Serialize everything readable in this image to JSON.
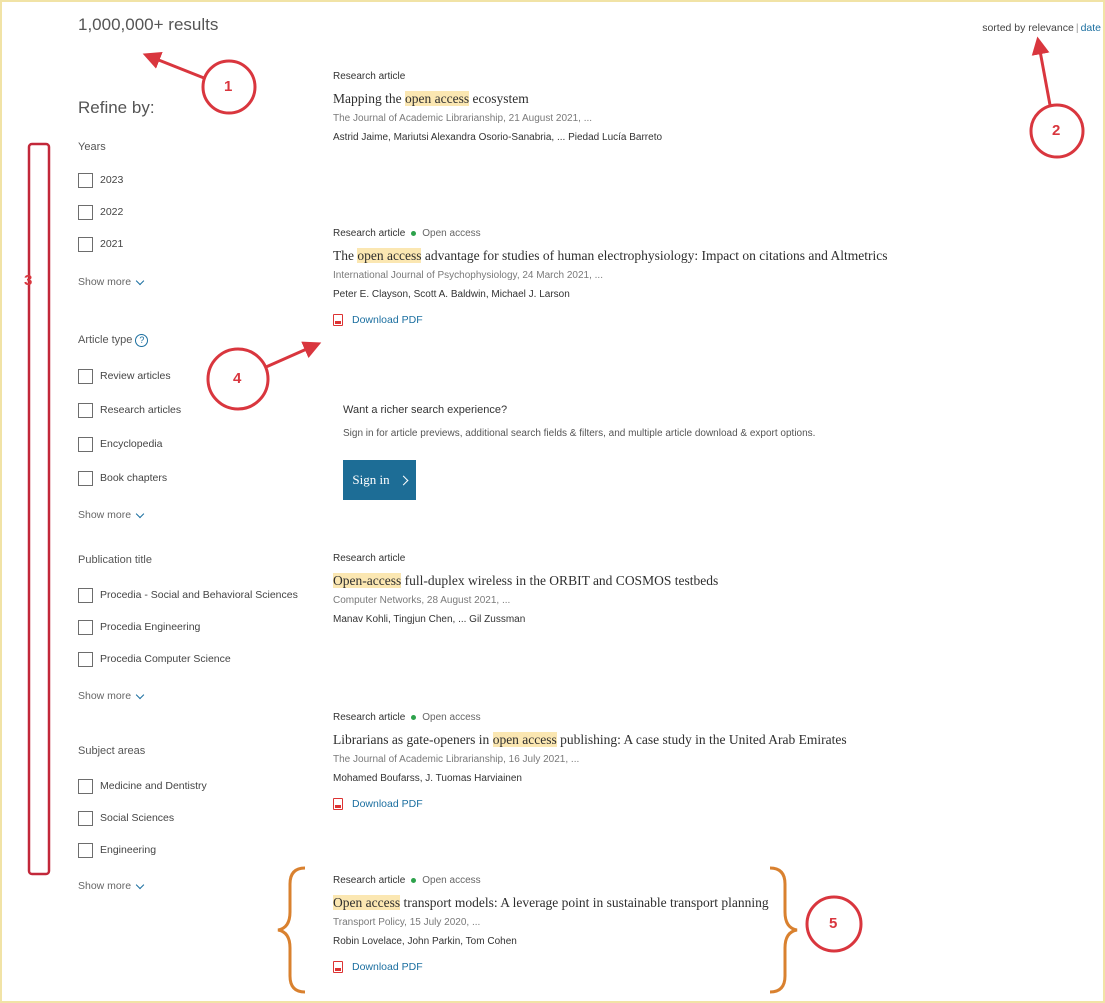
{
  "header": {
    "results_count": "1,000,000+ results",
    "sort_prefix": "sorted by relevance",
    "sort_separator": "|",
    "sort_date": "date"
  },
  "sidebar": {
    "refine_label": "Refine by:",
    "years": {
      "heading": "Years",
      "options": [
        "2023",
        "2022",
        "2021"
      ],
      "show_more": "Show more"
    },
    "article_type": {
      "heading": "Article type",
      "help_icon": "?",
      "options": [
        "Review articles",
        "Research articles",
        "Encyclopedia",
        "Book chapters"
      ],
      "show_more": "Show more"
    },
    "publication_title": {
      "heading": "Publication title",
      "options": [
        "Procedia - Social and Behavioral Sciences",
        "Procedia Engineering",
        "Procedia Computer Science"
      ],
      "show_more": "Show more"
    },
    "subject_areas": {
      "heading": "Subject areas",
      "options": [
        "Medicine and Dentistry",
        "Social Sciences",
        "Engineering"
      ],
      "show_more": "Show more"
    }
  },
  "results": [
    {
      "type": "Research article",
      "open_access": "",
      "title_before": "Mapping the ",
      "title_highlight": "open access",
      "title_after": " ecosystem",
      "source": "The Journal of Academic Librarianship, 21 August 2021, ...",
      "authors": "Astrid Jaime, Mariutsi Alexandra Osorio-Sanabria, ... Piedad Lucía Barreto",
      "download": ""
    },
    {
      "type": "Research article",
      "open_access": "Open access",
      "title_before": "The ",
      "title_highlight": "open access",
      "title_after": " advantage for studies of human electrophysiology: Impact on citations and Altmetrics",
      "source": "International Journal of Psychophysiology, 24 March 2021, ...",
      "authors": "Peter E. Clayson, Scott A. Baldwin, Michael J. Larson",
      "download": "Download PDF"
    },
    {
      "type": "Research article",
      "open_access": "",
      "title_before": "",
      "title_highlight": "Open-access",
      "title_after": " full-duplex wireless in the ORBIT and COSMOS testbeds",
      "source": "Computer Networks, 28 August 2021, ...",
      "authors": "Manav Kohli, Tingjun Chen, ... Gil Zussman",
      "download": ""
    },
    {
      "type": "Research article",
      "open_access": "Open access",
      "title_before": "Librarians as gate-openers in ",
      "title_highlight": "open access",
      "title_after": " publishing: A case study in the United Arab Emirates",
      "source": "The Journal of Academic Librarianship, 16 July 2021, ...",
      "authors": "Mohamed Boufarss, J. Tuomas Harviainen",
      "download": "Download PDF"
    },
    {
      "type": "Research article",
      "open_access": "Open access",
      "title_before": "",
      "title_highlight": "Open access",
      "title_after": " transport models: A leverage point in sustainable transport planning",
      "source": "Transport Policy, 15 July 2020, ...",
      "authors": "Robin Lovelace, John Parkin, Tom Cohen",
      "download": "Download PDF"
    }
  ],
  "promo": {
    "title": "Want a richer search experience?",
    "body": "Sign in for article previews, additional search fields & filters, and multiple article download & export options.",
    "signin_label": "Sign in"
  },
  "annotations": {
    "n1": "1",
    "n2": "2",
    "n3": "3",
    "n4": "4",
    "n5": "5",
    "red": "#d9363e",
    "orange": "#d9812f"
  }
}
